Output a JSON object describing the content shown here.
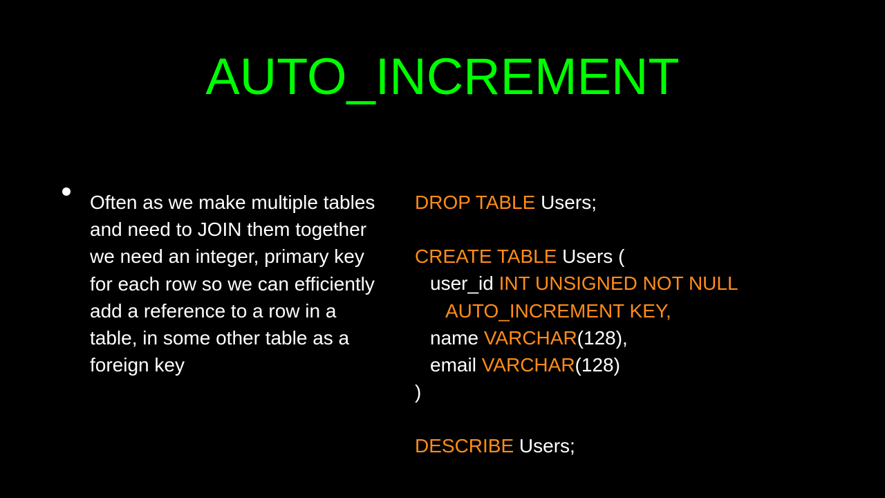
{
  "title": "AUTO_INCREMENT",
  "bullet_text": "Often as we make multiple tables and need to JOIN them together we need an integer, primary key for each row so we can efficiently add a reference to a row in a table, in some other table as a foreign key",
  "code": {
    "l1a": "DROP TABLE",
    "l1b": " Users;",
    "l2a": "CREATE TABLE",
    "l2b": " Users (",
    "l3a": "user_id",
    "l3b": " INT UNSIGNED NOT NULL",
    "l4": "AUTO_INCREMENT KEY,",
    "l5a": "name",
    "l5b": " VARCHAR",
    "l5c": "(128),",
    "l6a": "email",
    "l6b": " VARCHAR",
    "l6c": "(128)",
    "l7": ")",
    "l8a": "DESCRIBE",
    "l8b": " Users;"
  }
}
